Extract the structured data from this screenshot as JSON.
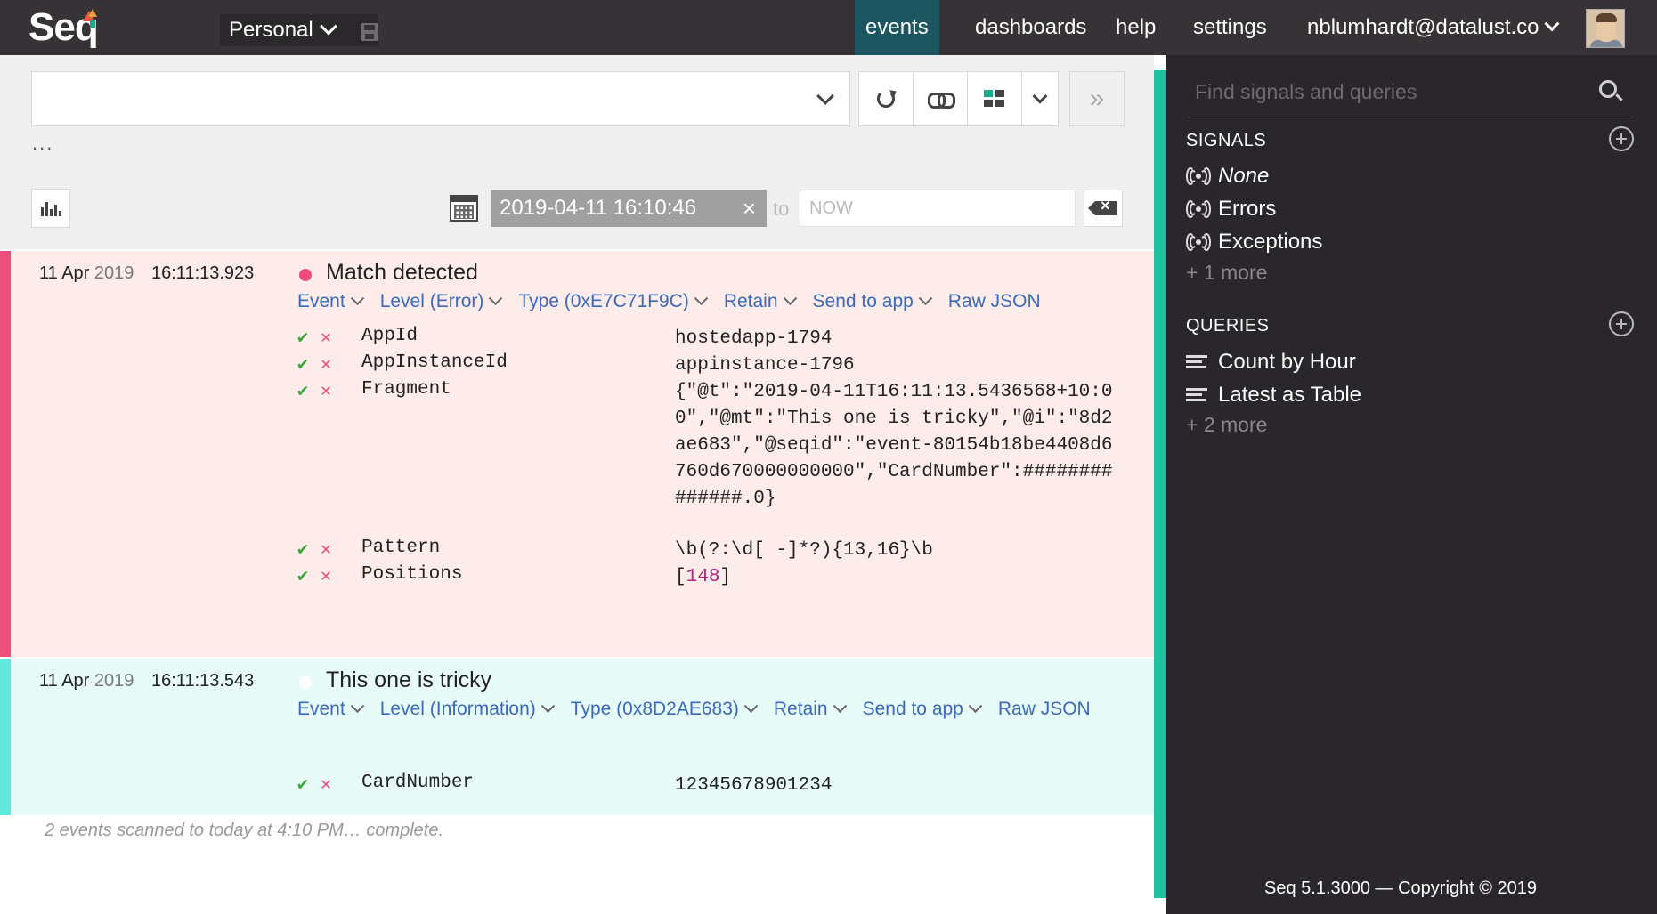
{
  "app": {
    "logo": "Seq",
    "workspace": "Personal"
  },
  "nav": {
    "events": "events",
    "dashboards": "dashboards",
    "help": "help",
    "settings": "settings",
    "user": "nblumhardt@datalust.co"
  },
  "toolbar": {
    "query_value": "",
    "more": "...",
    "date_from": "2019-04-11 16:10:46",
    "date_clear_symbol": "×",
    "to_label": "to",
    "date_to_placeholder": "NOW",
    "next_symbol": "»"
  },
  "events": [
    {
      "date": "11 Apr",
      "year": "2019",
      "time": "16:11:13.923",
      "message": "Match detected",
      "level_color": "#ee4d7d",
      "links": [
        "Event",
        "Level (Error)",
        "Type (0xE7C71F9C)",
        "Retain",
        "Send to app",
        "Raw JSON"
      ],
      "properties": [
        {
          "name": "AppId",
          "value": "hostedapp-1794"
        },
        {
          "name": "AppInstanceId",
          "value": "appinstance-1796"
        },
        {
          "name": "Fragment",
          "value": "{\"@t\":\"2019-04-11T16:11:13.5436568+10:00\",\"@mt\":\"This one is tricky\",\"@i\":\"8d2ae683\",\"@seqid\":\"event-80154b18be4408d6760d670000000000\",\"CardNumber\":##############.0}"
        },
        {
          "name": "Pattern",
          "value": "\\b(?:\\d[ -]*?){13,16}\\b"
        },
        {
          "name": "Positions",
          "value_prefix": "[",
          "value_num": "148",
          "value_suffix": "]"
        }
      ]
    },
    {
      "date": "11 Apr",
      "year": "2019",
      "time": "16:11:13.543",
      "message": "This one is tricky",
      "level_color": "#ffffff",
      "links": [
        "Event",
        "Level (Information)",
        "Type (0x8D2AE683)",
        "Retain",
        "Send to app",
        "Raw JSON"
      ],
      "properties": [
        {
          "name": "CardNumber",
          "value": "12345678901234"
        }
      ]
    }
  ],
  "status": "2 events scanned to today at 4:10 PM… complete.",
  "sidebar": {
    "search_placeholder": "Find signals and queries",
    "signals_header": "SIGNALS",
    "signals": [
      "None",
      "Errors",
      "Exceptions"
    ],
    "signals_more": "+ 1 more",
    "queries_header": "QUERIES",
    "queries": [
      "Count by Hour",
      "Latest as Table"
    ],
    "queries_more": "+ 2 more",
    "footer": "Seq 5.1.3000 — Copyright © 2019"
  },
  "colors": {
    "topbar": "#363236",
    "active_nav": "#1c5660",
    "accent": "#1ec29f",
    "error": "#ee4d7d",
    "info": "#5fe8dd"
  }
}
